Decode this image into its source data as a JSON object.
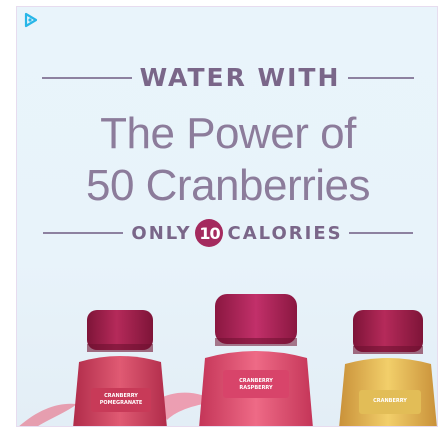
{
  "ad": {
    "adchoices_icon": "adchoices-triangle-icon",
    "kicker": "WATER WITH",
    "headline_line1": "The Power of",
    "headline_line2": "50 Cranberries",
    "calories_prefix": "ONLY",
    "calories_number": "10",
    "calories_suffix": "CALORIES"
  },
  "bottles": [
    {
      "label_line1": "CRANBERRY",
      "label_line2": "POMEGRANATE",
      "cap_color": "#a31f4d",
      "body_color": "#c93a5a"
    },
    {
      "label_line1": "CRANBERRY",
      "label_line2": "RASPBERRY",
      "cap_color": "#b01f55",
      "body_color": "#d8446a"
    },
    {
      "label_line1": "CRANBERRY",
      "label_line2": "",
      "cap_color": "#a31f4d",
      "body_color": "#d9b34a"
    }
  ],
  "colors": {
    "background": "#e8f3fa",
    "text": "#8c7c9b",
    "accent": "#a42a5e",
    "adchoices": "#28b6e8"
  }
}
